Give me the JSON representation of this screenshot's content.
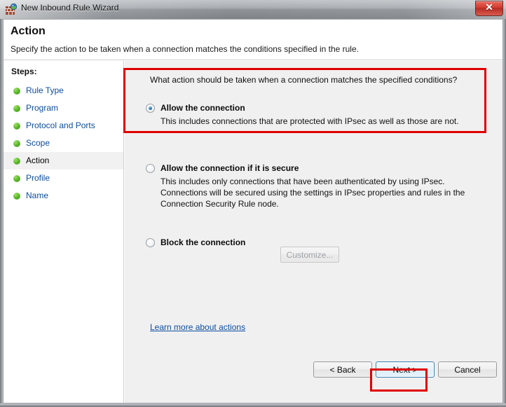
{
  "window": {
    "title": "New Inbound Rule Wizard",
    "icon": "firewall-globe-icon",
    "close_label": "x"
  },
  "header": {
    "title": "Action",
    "subtitle": "Specify the action to be taken when a connection matches the conditions specified in the rule."
  },
  "sidebar": {
    "label": "Steps:",
    "items": [
      {
        "label": "Rule Type",
        "current": false
      },
      {
        "label": "Program",
        "current": false
      },
      {
        "label": "Protocol and Ports",
        "current": false
      },
      {
        "label": "Scope",
        "current": false
      },
      {
        "label": "Action",
        "current": true
      },
      {
        "label": "Profile",
        "current": false
      },
      {
        "label": "Name",
        "current": false
      }
    ]
  },
  "main": {
    "question": "What action should be taken when a connection matches the specified conditions?",
    "options": [
      {
        "label": "Allow the connection",
        "description": "This includes connections that are protected with IPsec as well as those are not.",
        "selected": true
      },
      {
        "label": "Allow the connection if it is secure",
        "description": "This includes only connections that have been authenticated by using IPsec.  Connections will be secured using the settings in IPsec properties and rules in the Connection Security Rule node.",
        "selected": false
      },
      {
        "label": "Block the connection",
        "description": "",
        "selected": false
      }
    ],
    "customize_label": "Customize...",
    "learn_more_label": "Learn more about actions"
  },
  "buttons": {
    "back": "< Back",
    "next": "Next >",
    "cancel": "Cancel"
  },
  "annotations": {
    "color": "#e00000",
    "regions": [
      "allow-the-connection-option",
      "next-button"
    ]
  }
}
